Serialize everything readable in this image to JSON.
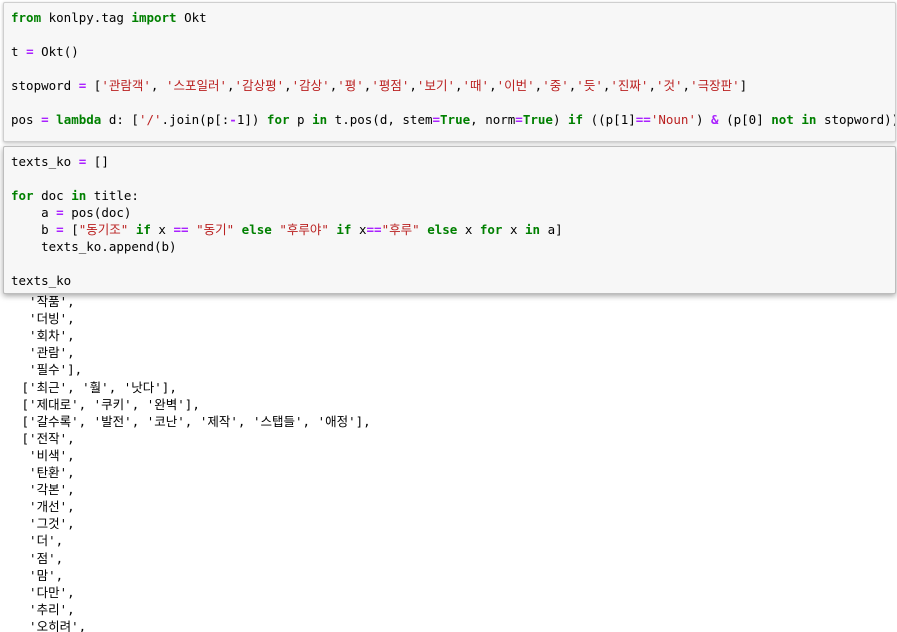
{
  "cell_1": {
    "lines": [
      [
        {
          "t": "from",
          "c": "kw"
        },
        {
          "t": " konlpy.tag ",
          "c": ""
        },
        {
          "t": "import",
          "c": "kw"
        },
        {
          "t": " Okt",
          "c": ""
        }
      ],
      [],
      [
        {
          "t": "t ",
          "c": ""
        },
        {
          "t": "=",
          "c": "op"
        },
        {
          "t": " Okt()",
          "c": ""
        }
      ],
      [],
      [
        {
          "t": "stopword ",
          "c": ""
        },
        {
          "t": "=",
          "c": "op"
        },
        {
          "t": " [",
          "c": ""
        },
        {
          "t": "'관람객'",
          "c": "str"
        },
        {
          "t": ", ",
          "c": ""
        },
        {
          "t": "'스포일러'",
          "c": "str"
        },
        {
          "t": ",",
          "c": ""
        },
        {
          "t": "'감상평'",
          "c": "str"
        },
        {
          "t": ",",
          "c": ""
        },
        {
          "t": "'감상'",
          "c": "str"
        },
        {
          "t": ",",
          "c": ""
        },
        {
          "t": "'평'",
          "c": "str"
        },
        {
          "t": ",",
          "c": ""
        },
        {
          "t": "'평점'",
          "c": "str"
        },
        {
          "t": ",",
          "c": ""
        },
        {
          "t": "'보기'",
          "c": "str"
        },
        {
          "t": ",",
          "c": ""
        },
        {
          "t": "'때'",
          "c": "str"
        },
        {
          "t": ",",
          "c": ""
        },
        {
          "t": "'이번'",
          "c": "str"
        },
        {
          "t": ",",
          "c": ""
        },
        {
          "t": "'중'",
          "c": "str"
        },
        {
          "t": ",",
          "c": ""
        },
        {
          "t": "'듯'",
          "c": "str"
        },
        {
          "t": ",",
          "c": ""
        },
        {
          "t": "'진짜'",
          "c": "str"
        },
        {
          "t": ",",
          "c": ""
        },
        {
          "t": "'것'",
          "c": "str"
        },
        {
          "t": ",",
          "c": ""
        },
        {
          "t": "'극장판'",
          "c": "str"
        },
        {
          "t": "]",
          "c": ""
        }
      ],
      [],
      [
        {
          "t": "pos ",
          "c": ""
        },
        {
          "t": "=",
          "c": "op"
        },
        {
          "t": " ",
          "c": ""
        },
        {
          "t": "lambda",
          "c": "kw"
        },
        {
          "t": " d: [",
          "c": ""
        },
        {
          "t": "'/'",
          "c": "str"
        },
        {
          "t": ".join(p[:",
          "c": ""
        },
        {
          "t": "-",
          "c": "op"
        },
        {
          "t": "1]) ",
          "c": ""
        },
        {
          "t": "for",
          "c": "kw"
        },
        {
          "t": " p ",
          "c": ""
        },
        {
          "t": "in",
          "c": "kw"
        },
        {
          "t": " t.pos(d, stem",
          "c": ""
        },
        {
          "t": "=",
          "c": "op"
        },
        {
          "t": "True",
          "c": "kw"
        },
        {
          "t": ", norm",
          "c": ""
        },
        {
          "t": "=",
          "c": "op"
        },
        {
          "t": "True",
          "c": "kw"
        },
        {
          "t": ") ",
          "c": ""
        },
        {
          "t": "if",
          "c": "kw"
        },
        {
          "t": " ((p[1]",
          "c": ""
        },
        {
          "t": "==",
          "c": "op"
        },
        {
          "t": "'Noun'",
          "c": "str"
        },
        {
          "t": ") ",
          "c": ""
        },
        {
          "t": "&",
          "c": "op"
        },
        {
          "t": " (p[0] ",
          "c": ""
        },
        {
          "t": "not",
          "c": "kw"
        },
        {
          "t": " ",
          "c": ""
        },
        {
          "t": "in",
          "c": "kw"
        },
        {
          "t": " stopword))]",
          "c": ""
        }
      ]
    ]
  },
  "cell_2": {
    "lines": [
      [
        {
          "t": "texts_ko ",
          "c": ""
        },
        {
          "t": "=",
          "c": "op"
        },
        {
          "t": " []",
          "c": ""
        }
      ],
      [],
      [
        {
          "t": "for",
          "c": "kw"
        },
        {
          "t": " doc ",
          "c": ""
        },
        {
          "t": "in",
          "c": "kw"
        },
        {
          "t": " title:",
          "c": ""
        }
      ],
      [
        {
          "t": "    a ",
          "c": ""
        },
        {
          "t": "=",
          "c": "op"
        },
        {
          "t": " pos(doc)",
          "c": ""
        }
      ],
      [
        {
          "t": "    b ",
          "c": ""
        },
        {
          "t": "=",
          "c": "op"
        },
        {
          "t": " [",
          "c": ""
        },
        {
          "t": "\"동기조\"",
          "c": "str"
        },
        {
          "t": " ",
          "c": ""
        },
        {
          "t": "if",
          "c": "kw"
        },
        {
          "t": " x ",
          "c": ""
        },
        {
          "t": "==",
          "c": "op"
        },
        {
          "t": " ",
          "c": ""
        },
        {
          "t": "\"동기\"",
          "c": "str"
        },
        {
          "t": " ",
          "c": ""
        },
        {
          "t": "else",
          "c": "kw"
        },
        {
          "t": " ",
          "c": ""
        },
        {
          "t": "\"후루야\"",
          "c": "str"
        },
        {
          "t": " ",
          "c": ""
        },
        {
          "t": "if",
          "c": "kw"
        },
        {
          "t": " x",
          "c": ""
        },
        {
          "t": "==",
          "c": "op"
        },
        {
          "t": "\"후루\"",
          "c": "str"
        },
        {
          "t": " ",
          "c": ""
        },
        {
          "t": "else",
          "c": "kw"
        },
        {
          "t": " x ",
          "c": ""
        },
        {
          "t": "for",
          "c": "kw"
        },
        {
          "t": " x ",
          "c": ""
        },
        {
          "t": "in",
          "c": "kw"
        },
        {
          "t": " a]",
          "c": ""
        }
      ],
      [
        {
          "t": "    texts_ko.append(b)",
          "c": ""
        }
      ],
      [],
      [
        {
          "t": "texts_ko",
          "c": ""
        }
      ]
    ]
  },
  "output": {
    "lines": [
      "  '작품',",
      "  '더빙',",
      "  '회차',",
      "  '관람',",
      "  '필수'],",
      " ['최근', '훨', '낫다'],",
      " ['제대로', '쿠키', '완벽'],",
      " ['갈수록', '발전', '코난', '제작', '스탭들', '애정'],",
      " ['전작',",
      "  '비색',",
      "  '탄환',",
      "  '각본',",
      "  '개선',",
      "  '그것',",
      "  '더',",
      "  '점',",
      "  '맘',",
      "  '다만',",
      "  '추리',",
      "  '오히려',"
    ]
  }
}
